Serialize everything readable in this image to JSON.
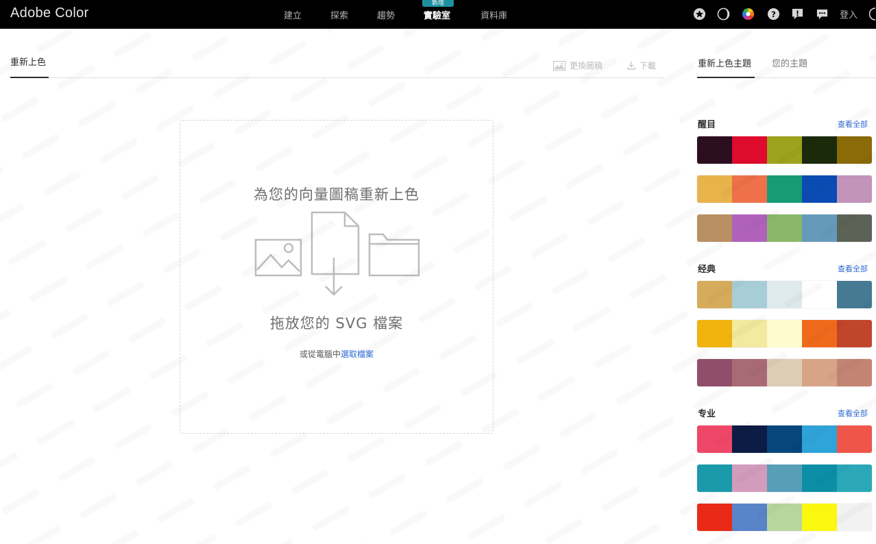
{
  "brand": "Adobe Color",
  "nav": {
    "items": [
      "建立",
      "探索",
      "趨勢",
      "實驗室",
      "資料庫"
    ],
    "new_badge": "新增"
  },
  "header_icons": [
    "star-icon",
    "moon-icon",
    "color-wheel-icon",
    "help-icon",
    "alert-icon",
    "chat-icon"
  ],
  "login": "登入",
  "left": {
    "tab": "重新上色",
    "replace_art": "更換圖稿",
    "download": "下載"
  },
  "dropzone": {
    "title": "為您的向量圖稿重新上色",
    "drop_text": "拖放您的 SVG 檔案",
    "sub_prefix": "或從電腦中",
    "sub_link": "選取檔案"
  },
  "right": {
    "tabs": [
      "重新上色主題",
      "您的主題"
    ],
    "view_all": "查看全部",
    "sections": [
      {
        "title": "醒目",
        "palettes": [
          [
            "#2b0e1f",
            "#de0b2c",
            "#9ea21e",
            "#1b2a0b",
            "#8b6a08"
          ],
          [
            "#e8b34a",
            "#ef714a",
            "#179a76",
            "#0b4cb4",
            "#c293bb"
          ],
          [
            "#b88f63",
            "#b062bb",
            "#89b86a",
            "#659bba",
            "#5c6256"
          ]
        ]
      },
      {
        "title": "经典",
        "palettes": [
          [
            "#d6ab5b",
            "#a7cdd6",
            "#dfeaec",
            "#ffffff",
            "#457a92"
          ],
          [
            "#f1b40f",
            "#f2ea9e",
            "#fffbd0",
            "#f06a1c",
            "#c1452a"
          ],
          [
            "#904e6c",
            "#a86b76",
            "#dccdb6",
            "#d8a488",
            "#c48473"
          ]
        ]
      },
      {
        "title": "专业",
        "palettes": [
          [
            "#ef4767",
            "#0d1c44",
            "#06467a",
            "#2fa4d8",
            "#ef5649"
          ],
          [
            "#1b9aab",
            "#d49cbc",
            "#579eb8",
            "#0c8fa6",
            "#2aa8b8"
          ],
          [
            "#e92a16",
            "#5a84c9",
            "#b7d69f",
            "#fbf70f",
            "#f2f2f2"
          ]
        ]
      }
    ]
  }
}
